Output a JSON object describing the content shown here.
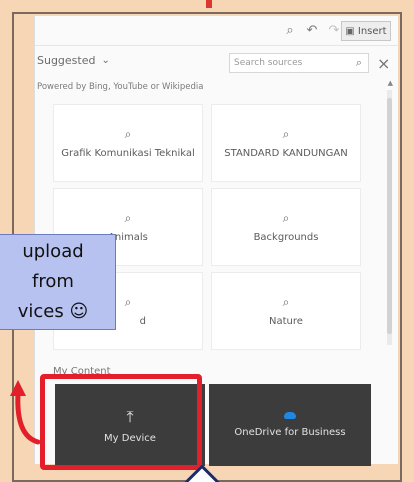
{
  "toolbar": {
    "insert_label": "Insert"
  },
  "filters": {
    "suggested_label": "Suggested",
    "search_placeholder": "Search sources"
  },
  "powered_by": "Powered by Bing, YouTube or Wikipedia",
  "suggested_tiles": [
    {
      "label": "Grafik Komunikasi Teknikal"
    },
    {
      "label": "STANDARD KANDUNGAN"
    },
    {
      "label": "Animals"
    },
    {
      "label": "Backgrounds"
    },
    {
      "label": "d"
    },
    {
      "label": "Nature"
    }
  ],
  "my_content": {
    "header": "My Content",
    "items": [
      {
        "label": "My Device"
      },
      {
        "label": "OneDrive for Business"
      }
    ]
  },
  "callout": {
    "lines": [
      "upload",
      "from",
      "vices ☺"
    ]
  }
}
